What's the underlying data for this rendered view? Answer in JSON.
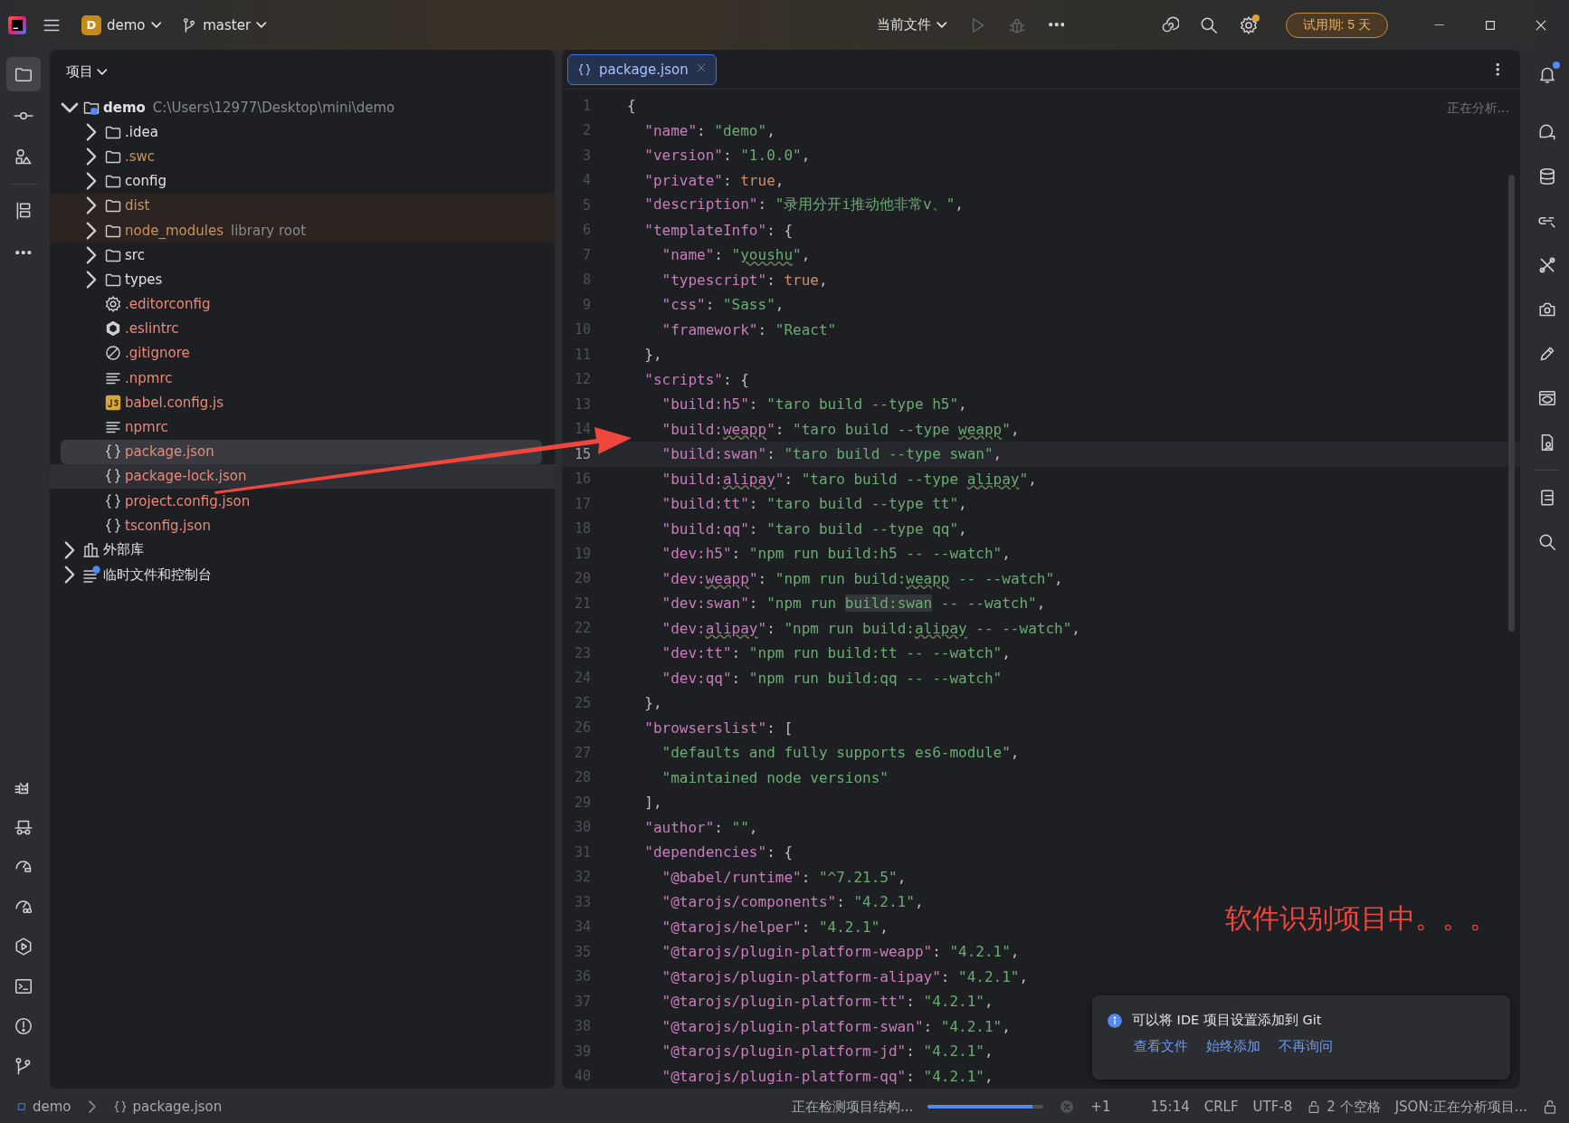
{
  "title_bar": {
    "project": {
      "badge": "D",
      "name": "demo"
    },
    "branch": "master",
    "run_config": "当前文件",
    "actions": [
      {
        "kind": "run",
        "disabled": true
      },
      {
        "kind": "debug",
        "disabled": true
      },
      {
        "kind": "more",
        "disabled": false
      }
    ],
    "tools": [
      {
        "kind": "spiral",
        "dot": false
      },
      {
        "kind": "search",
        "dot": false
      },
      {
        "kind": "gear",
        "dot": true
      }
    ],
    "trial": "试用期: 5 天"
  },
  "left_toolbar": {
    "top": [
      {
        "kind": "folder",
        "selected": true
      },
      {
        "kind": "commit",
        "selected": false
      },
      {
        "kind": "shapes",
        "selected": false
      },
      {
        "kind": "layout",
        "selected": false
      },
      {
        "kind": "more",
        "selected": false
      }
    ],
    "bottom": [
      {
        "kind": "cat",
        "selected": false
      },
      {
        "kind": "hat",
        "selected": false
      },
      {
        "kind": "gauge",
        "selected": false
      },
      {
        "kind": "speedometer",
        "selected": false
      },
      {
        "kind": "play",
        "selected": false
      },
      {
        "kind": "terminal",
        "selected": false
      },
      {
        "kind": "alert",
        "selected": false
      },
      {
        "kind": "branch",
        "selected": false
      }
    ]
  },
  "project_panel": {
    "title": "项目",
    "tree": [
      {
        "label": "demo",
        "hint": "C:\\Users\\12977\\Desktop\\mini\\demo",
        "kind": "module",
        "expanded": true,
        "selected": false,
        "children": [
          {
            "label": ".idea",
            "kind": "folder",
            "expanded": false,
            "selected": false,
            "excluded": false,
            "color": "#dfe1e5"
          },
          {
            "label": ".swc",
            "kind": "folder",
            "expanded": false,
            "selected": false,
            "excluded": false,
            "color": "#c7935c"
          },
          {
            "label": "config",
            "kind": "folder",
            "expanded": false,
            "selected": false,
            "excluded": false,
            "color": "#dfe1e5"
          },
          {
            "label": "dist",
            "kind": "folder",
            "expanded": false,
            "selected": false,
            "excluded": true,
            "color": "#c7935c"
          },
          {
            "label": "node_modules",
            "hint": "library root",
            "kind": "folder",
            "expanded": false,
            "selected": false,
            "excluded": true,
            "color": "#c7935c"
          },
          {
            "label": "src",
            "kind": "folder",
            "expanded": false,
            "selected": false,
            "excluded": false,
            "color": "#dfe1e5"
          },
          {
            "label": "types",
            "kind": "folder",
            "expanded": false,
            "selected": false,
            "excluded": false,
            "color": "#dfe1e5"
          },
          {
            "label": ".editorconfig",
            "kind": "gear",
            "selected": false,
            "excluded": false,
            "color": "#e8897b"
          },
          {
            "label": ".eslintrc",
            "kind": "hexagon",
            "selected": false,
            "excluded": false,
            "color": "#e8897b"
          },
          {
            "label": ".gitignore",
            "kind": "ignore",
            "selected": false,
            "excluded": false,
            "color": "#e8897b"
          },
          {
            "label": ".npmrc",
            "kind": "text",
            "selected": false,
            "excluded": false,
            "color": "#e8897b"
          },
          {
            "label": "babel.config.js",
            "kind": "js",
            "selected": false,
            "excluded": false,
            "color": "#e8897b"
          },
          {
            "label": "npmrc",
            "kind": "text",
            "selected": false,
            "excluded": false,
            "color": "#e8897b"
          },
          {
            "label": "package.json",
            "kind": "braces",
            "selected": true,
            "excluded": false,
            "color": "#e8897b"
          },
          {
            "label": "package-lock.json",
            "kind": "braces",
            "selected": false,
            "hover": true,
            "excluded": false,
            "color": "#e8897b"
          },
          {
            "label": "project.config.json",
            "kind": "braces",
            "selected": false,
            "excluded": false,
            "color": "#e8897b"
          },
          {
            "label": "tsconfig.json",
            "kind": "braces",
            "selected": false,
            "excluded": false,
            "color": "#e8897b"
          }
        ]
      },
      {
        "label": "外部库",
        "kind": "library",
        "expanded": false,
        "selected": false
      },
      {
        "label": "临时文件和控制台",
        "kind": "scratch",
        "expanded": false,
        "selected": false
      }
    ]
  },
  "editor": {
    "tabs": [
      {
        "label": "package.json",
        "selected": true
      }
    ],
    "analysis": "正在分析...",
    "lines": [
      {
        "number": "1",
        "current": false,
        "tokens": [
          {
            "kind": "punct",
            "text": "{"
          }
        ]
      },
      {
        "number": "2",
        "current": false,
        "tokens": [
          {
            "kind": "key",
            "text": "  \"name\""
          },
          {
            "kind": "punct",
            "text": ": "
          },
          {
            "kind": "string",
            "text": "\"demo\""
          },
          {
            "kind": "punct",
            "text": ","
          }
        ]
      },
      {
        "number": "3",
        "current": false,
        "tokens": [
          {
            "kind": "key",
            "text": "  \"version\""
          },
          {
            "kind": "punct",
            "text": ": "
          },
          {
            "kind": "string",
            "text": "\"1.0.0\""
          },
          {
            "kind": "punct",
            "text": ","
          }
        ]
      },
      {
        "number": "4",
        "current": false,
        "tokens": [
          {
            "kind": "key",
            "text": "  \"private\""
          },
          {
            "kind": "punct",
            "text": ": "
          },
          {
            "kind": "keyword",
            "text": "true"
          },
          {
            "kind": "punct",
            "text": ","
          }
        ]
      },
      {
        "number": "5",
        "current": false,
        "tokens": [
          {
            "kind": "key",
            "text": "  \"description\""
          },
          {
            "kind": "punct",
            "text": ": "
          },
          {
            "kind": "string",
            "text": "\"录用分开i推动他非常v、\""
          },
          {
            "kind": "punct",
            "text": ","
          }
        ]
      },
      {
        "number": "6",
        "current": false,
        "tokens": [
          {
            "kind": "key",
            "text": "  \"templateInfo\""
          },
          {
            "kind": "punct",
            "text": ": {"
          }
        ]
      },
      {
        "number": "7",
        "current": false,
        "tokens": [
          {
            "kind": "key",
            "text": "    \"name\""
          },
          {
            "kind": "punct",
            "text": ": "
          },
          {
            "kind": "string",
            "text": "\""
          },
          {
            "kind": "string_typo",
            "text": "youshu"
          },
          {
            "kind": "string",
            "text": "\""
          },
          {
            "kind": "punct",
            "text": ","
          }
        ]
      },
      {
        "number": "8",
        "current": false,
        "tokens": [
          {
            "kind": "key",
            "text": "    \"typescript\""
          },
          {
            "kind": "punct",
            "text": ": "
          },
          {
            "kind": "keyword",
            "text": "true"
          },
          {
            "kind": "punct",
            "text": ","
          }
        ]
      },
      {
        "number": "9",
        "current": false,
        "tokens": [
          {
            "kind": "key",
            "text": "    \"css\""
          },
          {
            "kind": "punct",
            "text": ": "
          },
          {
            "kind": "string",
            "text": "\"Sass\""
          },
          {
            "kind": "punct",
            "text": ","
          }
        ]
      },
      {
        "number": "10",
        "current": false,
        "tokens": [
          {
            "kind": "key",
            "text": "    \"framework\""
          },
          {
            "kind": "punct",
            "text": ": "
          },
          {
            "kind": "string",
            "text": "\"React\""
          }
        ]
      },
      {
        "number": "11",
        "current": false,
        "tokens": [
          {
            "kind": "punct",
            "text": "  },"
          }
        ]
      },
      {
        "number": "12",
        "current": false,
        "tokens": [
          {
            "kind": "key",
            "text": "  \"scripts\""
          },
          {
            "kind": "punct",
            "text": ": {"
          }
        ]
      },
      {
        "number": "13",
        "current": false,
        "tokens": [
          {
            "kind": "key",
            "text": "    \"build:h5\""
          },
          {
            "kind": "punct",
            "text": ": "
          },
          {
            "kind": "string",
            "text": "\"taro build --type h5\""
          },
          {
            "kind": "punct",
            "text": ","
          }
        ]
      },
      {
        "number": "14",
        "current": false,
        "tokens": [
          {
            "kind": "key",
            "text": "    \"build:"
          },
          {
            "kind": "key_typo",
            "text": "weapp"
          },
          {
            "kind": "key",
            "text": "\""
          },
          {
            "kind": "punct",
            "text": ": "
          },
          {
            "kind": "string",
            "text": "\"taro build --type "
          },
          {
            "kind": "string_typo",
            "text": "weapp"
          },
          {
            "kind": "string",
            "text": "\""
          },
          {
            "kind": "punct",
            "text": ","
          }
        ]
      },
      {
        "number": "15",
        "current": true,
        "tokens": [
          {
            "kind": "key",
            "text": "    \"build:swan\""
          },
          {
            "kind": "punct",
            "text": ": "
          },
          {
            "kind": "string",
            "text": "\"taro build --type swan\""
          },
          {
            "kind": "punct",
            "text": ","
          }
        ]
      },
      {
        "number": "16",
        "current": false,
        "tokens": [
          {
            "kind": "key",
            "text": "    \"build:"
          },
          {
            "kind": "key_typo",
            "text": "alipay"
          },
          {
            "kind": "key",
            "text": "\""
          },
          {
            "kind": "punct",
            "text": ": "
          },
          {
            "kind": "string",
            "text": "\"taro build --type "
          },
          {
            "kind": "string_typo",
            "text": "alipay"
          },
          {
            "kind": "string",
            "text": "\""
          },
          {
            "kind": "punct",
            "text": ","
          }
        ]
      },
      {
        "number": "17",
        "current": false,
        "tokens": [
          {
            "kind": "key",
            "text": "    \"build:tt\""
          },
          {
            "kind": "punct",
            "text": ": "
          },
          {
            "kind": "string",
            "text": "\"taro build --type tt\""
          },
          {
            "kind": "punct",
            "text": ","
          }
        ]
      },
      {
        "number": "18",
        "current": false,
        "tokens": [
          {
            "kind": "key",
            "text": "    \"build:qq\""
          },
          {
            "kind": "punct",
            "text": ": "
          },
          {
            "kind": "string",
            "text": "\"taro build --type qq\""
          },
          {
            "kind": "punct",
            "text": ","
          }
        ]
      },
      {
        "number": "19",
        "current": false,
        "tokens": [
          {
            "kind": "key",
            "text": "    \"dev:h5\""
          },
          {
            "kind": "punct",
            "text": ": "
          },
          {
            "kind": "string",
            "text": "\"npm run build:h5 -- --watch\""
          },
          {
            "kind": "punct",
            "text": ","
          }
        ]
      },
      {
        "number": "20",
        "current": false,
        "tokens": [
          {
            "kind": "key",
            "text": "    \"dev:"
          },
          {
            "kind": "key_typo",
            "text": "weapp"
          },
          {
            "kind": "key",
            "text": "\""
          },
          {
            "kind": "punct",
            "text": ": "
          },
          {
            "kind": "string",
            "text": "\"npm run build:"
          },
          {
            "kind": "string_typo",
            "text": "weapp"
          },
          {
            "kind": "string",
            "text": " -- --watch\""
          },
          {
            "kind": "punct",
            "text": ","
          }
        ]
      },
      {
        "number": "21",
        "current": false,
        "tokens": [
          {
            "kind": "key",
            "text": "    \"dev:swan\""
          },
          {
            "kind": "punct",
            "text": ": "
          },
          {
            "kind": "string",
            "text": "\"npm run "
          },
          {
            "kind": "match",
            "text": "build:swan"
          },
          {
            "kind": "string",
            "text": " -- --watch\""
          },
          {
            "kind": "punct",
            "text": ","
          }
        ]
      },
      {
        "number": "22",
        "current": false,
        "tokens": [
          {
            "kind": "key",
            "text": "    \"dev:"
          },
          {
            "kind": "key_typo",
            "text": "alipay"
          },
          {
            "kind": "key",
            "text": "\""
          },
          {
            "kind": "punct",
            "text": ": "
          },
          {
            "kind": "string",
            "text": "\"npm run build:"
          },
          {
            "kind": "string_typo",
            "text": "alipay"
          },
          {
            "kind": "string",
            "text": " -- --watch\""
          },
          {
            "kind": "punct",
            "text": ","
          }
        ]
      },
      {
        "number": "23",
        "current": false,
        "tokens": [
          {
            "kind": "key",
            "text": "    \"dev:tt\""
          },
          {
            "kind": "punct",
            "text": ": "
          },
          {
            "kind": "string",
            "text": "\"npm run build:tt -- --watch\""
          },
          {
            "kind": "punct",
            "text": ","
          }
        ]
      },
      {
        "number": "24",
        "current": false,
        "tokens": [
          {
            "kind": "key",
            "text": "    \"dev:qq\""
          },
          {
            "kind": "punct",
            "text": ": "
          },
          {
            "kind": "string",
            "text": "\"npm run build:qq -- --watch\""
          }
        ]
      },
      {
        "number": "25",
        "current": false,
        "tokens": [
          {
            "kind": "punct",
            "text": "  },"
          }
        ]
      },
      {
        "number": "26",
        "current": false,
        "tokens": [
          {
            "kind": "key",
            "text": "  \"browserslist\""
          },
          {
            "kind": "punct",
            "text": ": ["
          }
        ]
      },
      {
        "number": "27",
        "current": false,
        "tokens": [
          {
            "kind": "string",
            "text": "    \"defaults and fully supports es6-module\""
          },
          {
            "kind": "punct",
            "text": ","
          }
        ]
      },
      {
        "number": "28",
        "current": false,
        "tokens": [
          {
            "kind": "string",
            "text": "    \"maintained node versions\""
          }
        ]
      },
      {
        "number": "29",
        "current": false,
        "tokens": [
          {
            "kind": "punct",
            "text": "  ],"
          }
        ]
      },
      {
        "number": "30",
        "current": false,
        "tokens": [
          {
            "kind": "key",
            "text": "  \"author\""
          },
          {
            "kind": "punct",
            "text": ": "
          },
          {
            "kind": "string",
            "text": "\"\""
          },
          {
            "kind": "punct",
            "text": ","
          }
        ]
      },
      {
        "number": "31",
        "current": false,
        "tokens": [
          {
            "kind": "key",
            "text": "  \"dependencies\""
          },
          {
            "kind": "punct",
            "text": ": {"
          }
        ]
      },
      {
        "number": "32",
        "current": false,
        "tokens": [
          {
            "kind": "key",
            "text": "    \"@babel/runtime\""
          },
          {
            "kind": "punct",
            "text": ": "
          },
          {
            "kind": "string",
            "text": "\"^7.21.5\""
          },
          {
            "kind": "punct",
            "text": ","
          }
        ]
      },
      {
        "number": "33",
        "current": false,
        "tokens": [
          {
            "kind": "key",
            "text": "    \"@tarojs/components\""
          },
          {
            "kind": "punct",
            "text": ": "
          },
          {
            "kind": "string",
            "text": "\"4.2.1\""
          },
          {
            "kind": "punct",
            "text": ","
          }
        ]
      },
      {
        "number": "34",
        "current": false,
        "tokens": [
          {
            "kind": "key",
            "text": "    \"@tarojs/helper\""
          },
          {
            "kind": "punct",
            "text": ": "
          },
          {
            "kind": "string",
            "text": "\"4.2.1\""
          },
          {
            "kind": "punct",
            "text": ","
          }
        ]
      },
      {
        "number": "35",
        "current": false,
        "tokens": [
          {
            "kind": "key",
            "text": "    \"@tarojs/plugin-platform-weapp\""
          },
          {
            "kind": "punct",
            "text": ": "
          },
          {
            "kind": "string",
            "text": "\"4.2.1\""
          },
          {
            "kind": "punct",
            "text": ","
          }
        ]
      },
      {
        "number": "36",
        "current": false,
        "tokens": [
          {
            "kind": "key",
            "text": "    \"@tarojs/plugin-platform-alipay\""
          },
          {
            "kind": "punct",
            "text": ": "
          },
          {
            "kind": "string",
            "text": "\"4.2.1\""
          },
          {
            "kind": "punct",
            "text": ","
          }
        ]
      },
      {
        "number": "37",
        "current": false,
        "tokens": [
          {
            "kind": "key",
            "text": "    \"@tarojs/plugin-platform-tt\""
          },
          {
            "kind": "punct",
            "text": ": "
          },
          {
            "kind": "string",
            "text": "\"4.2.1\""
          },
          {
            "kind": "punct",
            "text": ","
          }
        ]
      },
      {
        "number": "38",
        "current": false,
        "tokens": [
          {
            "kind": "key",
            "text": "    \"@tarojs/plugin-platform-swan\""
          },
          {
            "kind": "punct",
            "text": ": "
          },
          {
            "kind": "string",
            "text": "\"4.2.1\""
          },
          {
            "kind": "punct",
            "text": ","
          }
        ]
      },
      {
        "number": "39",
        "current": false,
        "tokens": [
          {
            "kind": "key",
            "text": "    \"@tarojs/plugin-platform-jd\""
          },
          {
            "kind": "punct",
            "text": ": "
          },
          {
            "kind": "string",
            "text": "\"4.2.1\""
          },
          {
            "kind": "punct",
            "text": ","
          }
        ]
      },
      {
        "number": "40",
        "current": false,
        "tokens": [
          {
            "kind": "key",
            "text": "    \"@tarojs/plugin-platform-qq\""
          },
          {
            "kind": "punct",
            "text": ": "
          },
          {
            "kind": "string",
            "text": "\"4.2.1\""
          },
          {
            "kind": "punct",
            "text": ","
          }
        ]
      }
    ]
  },
  "notification": {
    "message": "可以将 IDE 项目设置添加到 Git",
    "links": [
      "查看文件",
      "始终添加",
      "不再询问"
    ]
  },
  "annotation": {
    "text": "软件识别项目中。。。"
  },
  "right_toolbar": [
    {
      "kind": "bell",
      "dot": true
    },
    {
      "kind": "chat",
      "dot": false
    },
    {
      "kind": "database",
      "dot": false
    },
    {
      "kind": "link",
      "dot": false
    },
    {
      "kind": "tools",
      "dot": false
    },
    {
      "kind": "camera",
      "dot": false
    },
    {
      "kind": "pencil",
      "dot": false
    },
    {
      "kind": "eye",
      "dot": false
    },
    {
      "kind": "document",
      "dot": false
    },
    {
      "kind": "clipboard",
      "dot": false
    },
    {
      "kind": "search",
      "dot": false
    }
  ],
  "status_bar": {
    "breadcrumbs": [
      {
        "label": "demo",
        "kind": "module"
      },
      {
        "label": "package.json",
        "kind": "braces"
      }
    ],
    "progress": {
      "label": "正在检测项目结构...",
      "level": 0.9
    },
    "extra": "+1",
    "position": "15:14",
    "line_ending": "CRLF",
    "encoding": "UTF-8",
    "indent": "2 个空格",
    "language": "JSON:正在分析项目..."
  }
}
